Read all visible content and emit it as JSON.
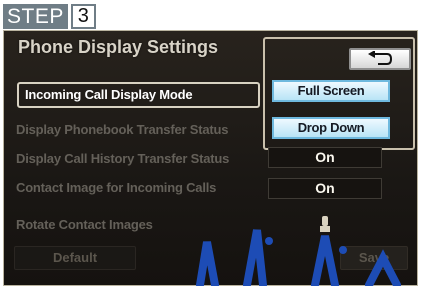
{
  "step": {
    "label": "STEP",
    "number": "3"
  },
  "screen": {
    "title": "Phone Display Settings",
    "back_icon": "return-arrow-icon",
    "rows": [
      {
        "label": "Incoming Call Display Mode",
        "active": true
      },
      {
        "label": "Display Phonebook Transfer Status"
      },
      {
        "label": "Display Call History Transfer Status",
        "value": "On"
      },
      {
        "label": "Contact Image for Incoming Calls",
        "value": "On"
      },
      {
        "label": "Rotate Contact Images"
      }
    ],
    "options": [
      "Full Screen",
      "Drop Down"
    ],
    "buttons": {
      "default": "Default",
      "save": "Save"
    }
  },
  "colors": {
    "accent": "#6fb9de",
    "title_text": "#d8d3c7",
    "step_badge": "#6f7d86"
  }
}
